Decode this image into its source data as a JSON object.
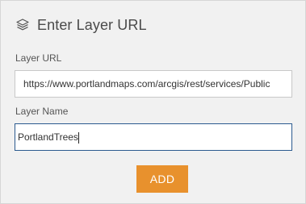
{
  "header": {
    "icon": "layers-icon",
    "title": "Enter Layer URL"
  },
  "layer_url": {
    "label": "Layer URL",
    "value": "https://www.portlandmaps.com/arcgis/rest/services/Public"
  },
  "layer_name": {
    "label": "Layer Name",
    "value": "PortlandTrees"
  },
  "actions": {
    "add_label": "ADD"
  },
  "colors": {
    "panel_bg": "#f1f1f1",
    "accent": "#e8912d",
    "focus_border": "#2b5a8f"
  }
}
